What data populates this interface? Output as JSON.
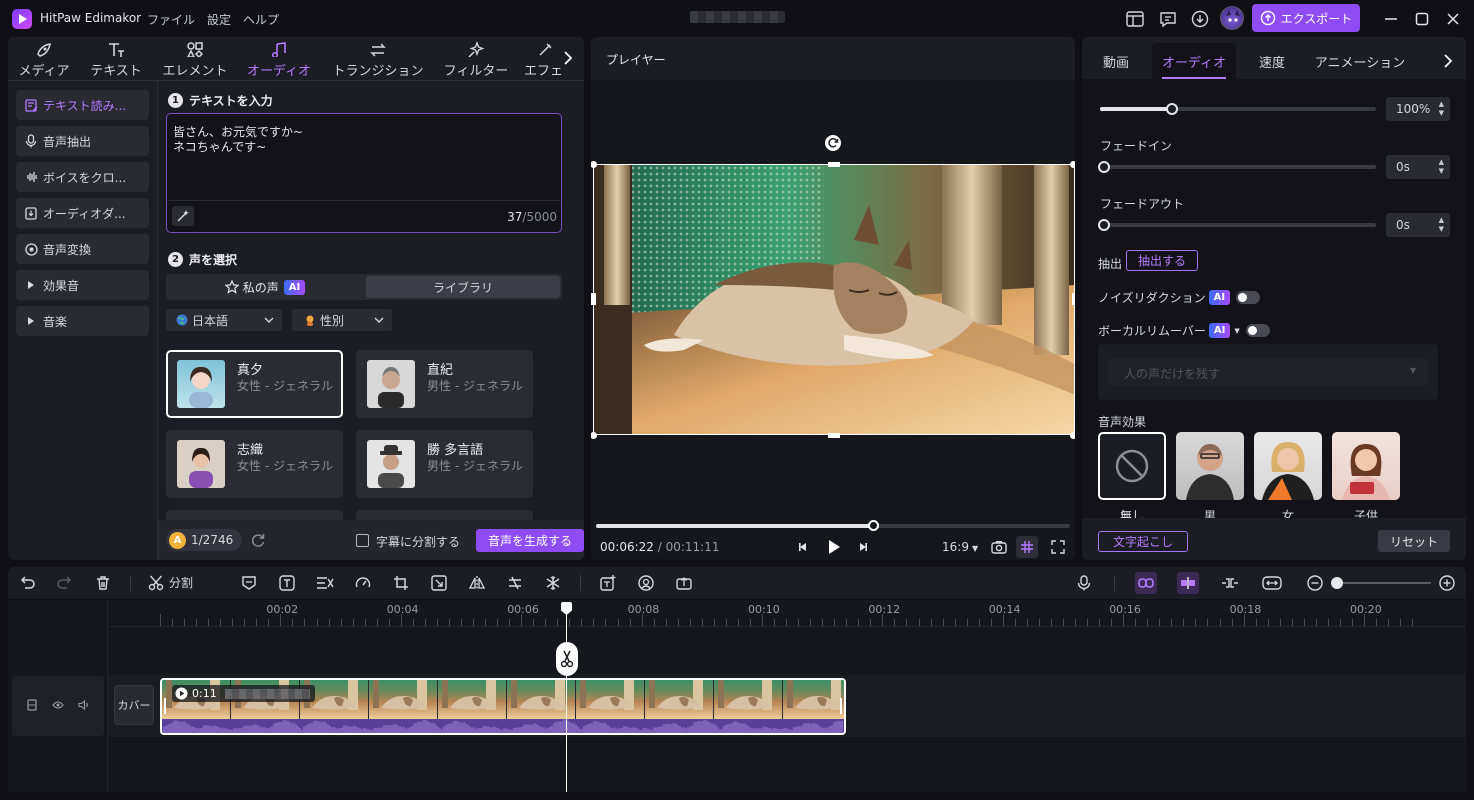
{
  "app": {
    "title": "HitPaw Edimakor",
    "menu": [
      "ファイル",
      "設定",
      "ヘルプ"
    ],
    "export_label": "エクスポート"
  },
  "media_tabs": [
    "メディア",
    "テキスト",
    "エレメント",
    "オーディオ",
    "トランジション",
    "フィルター",
    "エフェ"
  ],
  "sidebar": [
    {
      "label": "テキスト読み...",
      "icon": "text-to-speech-icon",
      "active": true
    },
    {
      "label": "音声抽出",
      "icon": "microphone-icon"
    },
    {
      "label": "ボイスをクロ...",
      "icon": "waveform-icon"
    },
    {
      "label": "オーディオダ...",
      "icon": "download-audio-icon"
    },
    {
      "label": "音声変換",
      "icon": "voice-change-icon"
    },
    {
      "label": "効果音",
      "icon": "caret-right-icon"
    },
    {
      "label": "音楽",
      "icon": "caret-right-icon"
    }
  ],
  "tts": {
    "step1_num": "1",
    "step1_title": "テキストを入力",
    "text_line1": "皆さん、お元気ですか~",
    "text_line2": "ネコちゃんです~",
    "char_count": "37",
    "char_limit": "/5000",
    "step2_num": "2",
    "step2_title": "声を選択",
    "my_voice_tab": "私の声",
    "ai_badge": "AI",
    "library_tab": "ライブラリ",
    "language": "日本語",
    "gender": "性別",
    "voices": [
      {
        "name": "真夕",
        "desc": "女性 - ジェネラル"
      },
      {
        "name": "直紀",
        "desc": "男性 - ジェネラル"
      },
      {
        "name": "志織",
        "desc": "女性 - ジェネラル"
      },
      {
        "name": "勝 多言語",
        "desc": "男性 - ジェネラル"
      }
    ],
    "credits": "1/2746",
    "credit_icon_letter": "A",
    "split_subtitle": "字幕に分割する",
    "generate_button": "音声を生成する"
  },
  "player": {
    "title": "プレイヤー",
    "current_time": "00:06:22",
    "total_time": "/ 00:11:11",
    "aspect": "16:9",
    "progress": 0.585
  },
  "props": {
    "tabs": [
      "動画",
      "オーディオ",
      "速度",
      "アニメーション"
    ],
    "volume": {
      "value": "100%",
      "level": 0.26
    },
    "fade_in_label": "フェードイン",
    "fade_in_value": "0s",
    "fade_out_label": "フェードアウト",
    "fade_out_value": "0s",
    "extract_label": "抽出",
    "extract_button": "抽出する",
    "noise_label": "ノイズリダクション",
    "vocal_label": "ボーカルリムーバー",
    "vocal_placeholder": "人の声だけを残す",
    "fx_title": "音声効果",
    "fx": [
      "無し",
      "男",
      "女",
      "子供"
    ],
    "transcribe_button": "文字起こし",
    "reset_button": "リセット"
  },
  "timeline": {
    "split_label": "分割",
    "ruler": [
      "00:02",
      "00:04",
      "00:06",
      "00:08",
      "00:10",
      "00:12",
      "00:14",
      "00:16",
      "00:18",
      "00:20"
    ],
    "cover_label": "カバー",
    "clip_duration": "0:11"
  },
  "colors": {
    "accent": "#8f4cf5",
    "accent_light": "#b57cff",
    "panel": "#1c1c24",
    "bg": "#0f0f15"
  }
}
